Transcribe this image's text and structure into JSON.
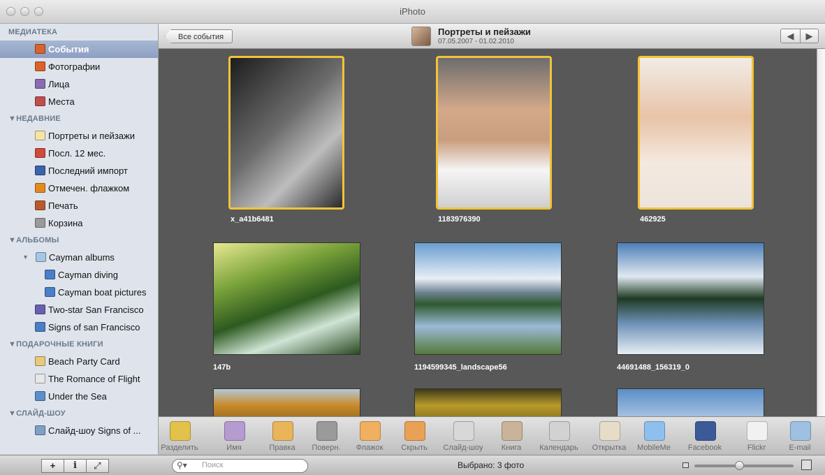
{
  "window": {
    "title": "iPhoto"
  },
  "sidebar": {
    "sections": [
      {
        "label": "МЕДИАТЕКА",
        "items": [
          {
            "label": "События",
            "icon": "events-icon",
            "color": "#d9632b",
            "selected": true
          },
          {
            "label": "Фотографии",
            "icon": "photos-icon",
            "color": "#d9632b"
          },
          {
            "label": "Лица",
            "icon": "faces-icon",
            "color": "#8a6bb3"
          },
          {
            "label": "Места",
            "icon": "places-icon",
            "color": "#c24d4d"
          }
        ]
      },
      {
        "label": "▼НЕДАВНИЕ",
        "items": [
          {
            "label": "Портреты и пейзажи",
            "icon": "event-icon",
            "color": "#f4e4a8"
          },
          {
            "label": "Посл. 12 мес.",
            "icon": "calendar-icon",
            "color": "#d14a3c"
          },
          {
            "label": "Последний импорт",
            "icon": "import-icon",
            "color": "#3b63a8"
          },
          {
            "label": "Отмечен. флажком",
            "icon": "flag-icon",
            "color": "#e38a1f"
          },
          {
            "label": "Печать",
            "icon": "print-icon",
            "color": "#b85a2e"
          },
          {
            "label": "Корзина",
            "icon": "trash-icon",
            "color": "#9a9a9a"
          }
        ]
      },
      {
        "label": "▼АЛЬБОМЫ",
        "items": [
          {
            "label": "Cayman albums",
            "icon": "folder-icon",
            "color": "#a6c6e6",
            "disclosure": "▼"
          },
          {
            "label": "Cayman diving",
            "icon": "album-icon",
            "color": "#4a7fc8",
            "indent": 2
          },
          {
            "label": "Cayman boat pictures",
            "icon": "album-icon",
            "color": "#4a7fc8",
            "indent": 2
          },
          {
            "label": "Two-star San Francisco",
            "icon": "smart-album-icon",
            "color": "#6a5fb0"
          },
          {
            "label": "Signs of san Francisco",
            "icon": "album-icon",
            "color": "#4a7fc8"
          }
        ]
      },
      {
        "label": "▼ПОДАРОЧНЫЕ КНИГИ",
        "items": [
          {
            "label": "Beach Party Card",
            "icon": "card-icon",
            "color": "#e9c97a"
          },
          {
            "label": "The Romance of Flight",
            "icon": "calendar-project-icon",
            "color": "#e7e7e7"
          },
          {
            "label": "Under the Sea",
            "icon": "book-icon",
            "color": "#5a8fc9"
          }
        ]
      },
      {
        "label": "▼СЛАЙД-ШОУ",
        "items": [
          {
            "label": "Слайд-шоу Signs of ...",
            "icon": "slideshow-icon",
            "color": "#7f9fc4"
          }
        ]
      }
    ]
  },
  "header": {
    "back_label": "Все события",
    "event_title": "Портреты и пейзажи",
    "event_dates": "07.05.2007 - 01.02.2010",
    "nav_prev": "◀",
    "nav_next": "▶"
  },
  "photos": [
    {
      "caption": "x_a41b6481",
      "selected": true,
      "fill": "linear-gradient(135deg,#1d1d1d,#6b6b6b 45%,#bdbdbd 70%,#2a2a2a)"
    },
    {
      "caption": "1183976390",
      "selected": true,
      "fill": "linear-gradient(180deg,#6d6d6d,#d4a98a 35%,#c99e7f 55%,#f5f5f5 75%,#cfcfcf)"
    },
    {
      "caption": "462925",
      "selected": true,
      "fill": "linear-gradient(180deg,#f1ece6,#e8c3a8 40%,#f4e9df 70%,#ece4dc)"
    },
    {
      "caption": "147b",
      "selected": false,
      "fill": "linear-gradient(160deg,#e6e890,#7aa23a 30%,#2d5a1f 55%,#cfe4d5 75%,#2a4a22)"
    },
    {
      "caption": "1194599345_landscape56",
      "selected": false,
      "fill": "linear-gradient(180deg,#6a9ed0,#e8eef5 32%,#6a7f8e 45%,#2f5a2f 55%,#9bbad6 75%,#557a3a)"
    },
    {
      "caption": "44691488_156319_0",
      "selected": false,
      "fill": "linear-gradient(180deg,#4d7fb8,#dfe8f0 30%,#1e3a22 50%,#6d90b6 72%,#e6eef4)"
    },
    {
      "caption": "",
      "selected": false,
      "fill": "linear-gradient(180deg,#b4c8d6,#c98a2a 40%,#7a5a1e)"
    },
    {
      "caption": "",
      "selected": false,
      "fill": "linear-gradient(180deg,#3d3a1a,#b89a2a 40%,#6a5a1a)"
    },
    {
      "caption": "",
      "selected": false,
      "fill": "linear-gradient(180deg,#5a8ec8,#c8d8ea)"
    }
  ],
  "toolbar": [
    {
      "label": "Разделить",
      "icon": "split-icon",
      "color": "#e2c24a"
    },
    {
      "label": "Имя",
      "icon": "name-icon",
      "color": "#b59bd0"
    },
    {
      "label": "Правка",
      "icon": "edit-icon",
      "color": "#e9b45a"
    },
    {
      "label": "Поверн.",
      "icon": "rotate-icon",
      "color": "#9a9a9a"
    },
    {
      "label": "Флажок",
      "icon": "flag-icon",
      "color": "#f0b060"
    },
    {
      "label": "Скрыть",
      "icon": "hide-icon",
      "color": "#e9a255"
    },
    {
      "label": "Слайд-шоу",
      "icon": "play-icon",
      "color": "#d8d8d8"
    },
    {
      "label": "Книга",
      "icon": "book-icon",
      "color": "#c9b49a"
    },
    {
      "label": "Календарь",
      "icon": "calendar-icon",
      "color": "#d2d2d2"
    },
    {
      "label": "Открытка",
      "icon": "card-icon",
      "color": "#e6dcc8"
    },
    {
      "label": "MobileMe",
      "icon": "cloud-icon",
      "color": "#8ec0ef"
    },
    {
      "label": "Facebook",
      "icon": "facebook-icon",
      "color": "#3b5b98"
    },
    {
      "label": "Flickr",
      "icon": "flickr-icon",
      "color": "#f1f1f1"
    },
    {
      "label": "E-mail",
      "icon": "email-icon",
      "color": "#9fc0e0"
    }
  ],
  "bottom": {
    "add_label": "+",
    "info_label": "i",
    "fullscreen_label": "⤢",
    "search_placeholder": "Поиск",
    "status": "Выбрано: 3 фото",
    "zoom_value": 0.45
  }
}
